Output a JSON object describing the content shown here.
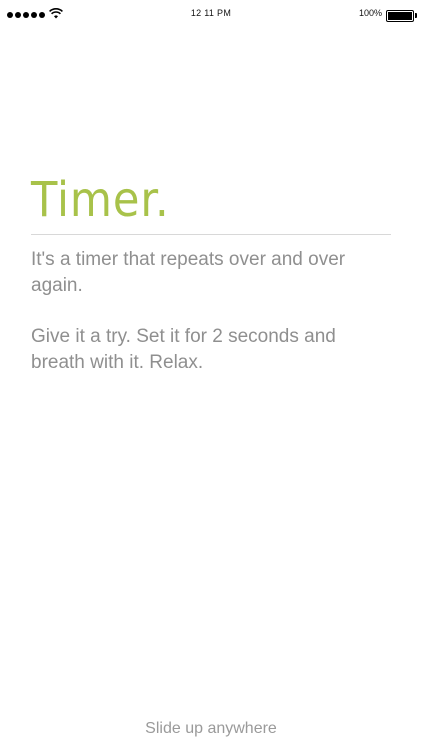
{
  "status_bar": {
    "signal_dots": 5,
    "time": "12 11 PM",
    "battery": "100%",
    "battery_level": 1.0
  },
  "content": {
    "title": "Timer.",
    "paragraph_1": "It's a timer that repeats over and over again.",
    "paragraph_2": "Give it a try. Set it for 2 seconds and breath with it. Relax."
  },
  "footer": {
    "hint": "Slide up anywhere"
  },
  "colors": {
    "accent": "#a8c24a",
    "body_text": "#8f8f8f",
    "hint_text": "#9a9a9a",
    "background": "#ffffff"
  },
  "icons": {
    "signal": "signal-strength-icon",
    "wifi": "wifi-icon",
    "battery": "battery-icon"
  }
}
